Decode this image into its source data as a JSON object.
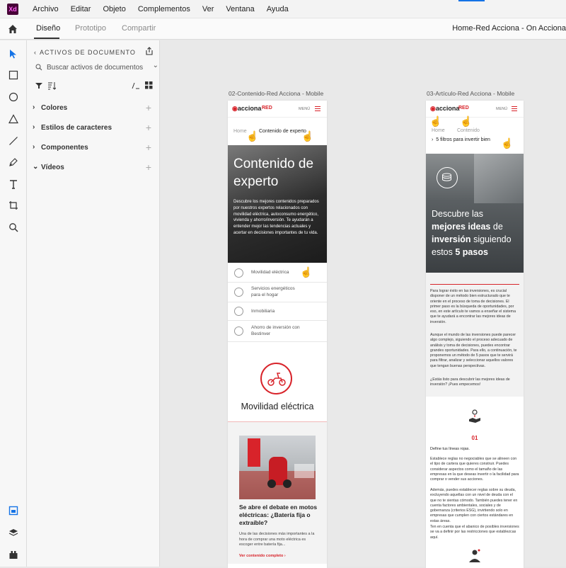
{
  "app": {
    "logo_text": "Xd",
    "menu": [
      "Archivo",
      "Editar",
      "Objeto",
      "Complementos",
      "Ver",
      "Ventana",
      "Ayuda"
    ],
    "tabs": [
      "Diseño",
      "Prototipo",
      "Compartir"
    ],
    "document_title": "Home-Red Acciona - On Acciona"
  },
  "assets_panel": {
    "header": "ACTIVOS DE DOCUMENTO",
    "search_placeholder": "Buscar activos de documentos",
    "sections": [
      "Colores",
      "Estilos de caracteres",
      "Componentes",
      "Vídeos"
    ]
  },
  "artboard1": {
    "label": "02-Contenido-Red Acciona - Mobile",
    "logo": "acciona",
    "logo_red": "RED",
    "menu_label": "MENÚ",
    "breadcrumb_home": "Home",
    "breadcrumb_current": "Contenido de experto",
    "hero_title_line1": "Contenido de",
    "hero_title_line2": "experto",
    "hero_desc": "Descubre los mejores contenidos preparados por nuestros expertos relacionados con movilidad eléctrica, autoconsumo energético, vivienda y ahorro/inversión. Te ayudarán a entender mejor las tendencias actuales y acertar en decisiones importantes de tu vida.",
    "categories": [
      "Movilidad eléctrica",
      "Servicios energéticos para el hogar",
      "Inmobiliaria",
      "Ahorro de inversión con Bestinver"
    ],
    "section_title": "Movilidad eléctrica",
    "card_title": "Se abre el debate en motos eléctricas: ¿Batería fija o extraíble?",
    "card_text": "Una de las decisiones más importantes a la hora de comprar una moto eléctrica es escoger entre batería fija...",
    "card_link": "Ver contenido completo"
  },
  "artboard2": {
    "label": "03-Artículo-Red Acciona - Mobile",
    "logo": "acciona",
    "logo_red": "RED",
    "menu_label": "MENÚ",
    "breadcrumb_home": "Home",
    "breadcrumb_mid": "Contenido",
    "breadcrumb_current": "5 filtros para invertir bien",
    "hero_l1": "Descubre las",
    "hero_l2a": "mejores ideas",
    "hero_l2b": "de",
    "hero_l3a": "inversión",
    "hero_l3b": "siguiendo",
    "hero_l4a": "estos",
    "hero_l4b": "5 pasos",
    "para1": "Para lograr éxito en las inversiones, es crucial disponer de un método bien estructurado que te oriente en el proceso de toma de decisiones. El primer paso es la búsqueda de oportunidades, por eso, en este artículo te vamos a enseñar el sistema que te ayudará a encontrar las mejores ideas de inversión.",
    "para2": "Aunque el mundo de las inversiones puede parecer algo complejo, siguiendo el proceso adecuado de análisis y toma de decisiones, puedes encontrar grandes oportunidades. Para ello, a continuación, te proponemos un método de 5 pasos que te servirá para filtrar, analizar y seleccionar aquellos valores que tengan buenas perspectivas.",
    "para3": "¿Estás listo para descubrir las mejores ideas de inversión? ¡Pues empecemos!",
    "step_number": "01",
    "step_title": "Define tus líneas rojas.",
    "para4": "Establece reglas no negociables que se alineen con el tipo de cartera que quieres construir. Puedes considerar aspectos como el tamaño de las empresas en la que deseas invertir o la facilidad para comprar o vender sus acciones.",
    "para5": "Además, puedes establecer reglas sobre su deuda, excluyendo aquellas con un nivel de deuda con el que no te sientas cómodo. También puedes tener en cuenta factores ambientales, sociales y de gobernanza (criterios ESG), invirtiendo solo en empresas que cumplen con ciertos estándares en estas áreas.",
    "para6": "Ten en cuenta que el abanico de posibles inversiones se va a definir por las restricciones que establezcas aquí."
  },
  "colors": {
    "accent": "#d8232a",
    "xd_bg": "#470137",
    "xd_fg": "#ff61f6",
    "selection": "#1473e6"
  }
}
